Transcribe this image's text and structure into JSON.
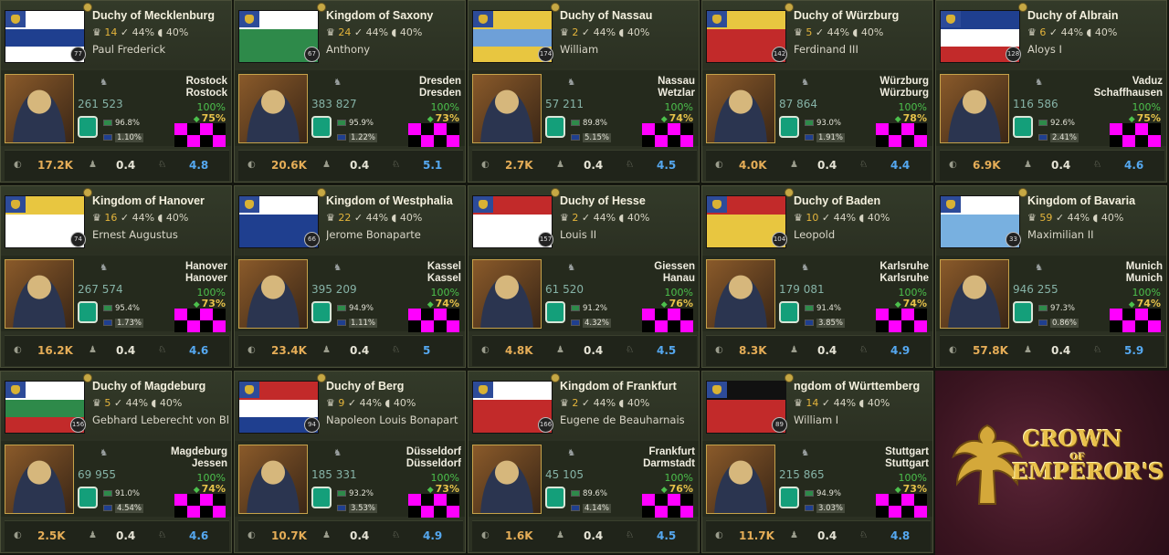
{
  "cards": [
    {
      "name": "Duchy of Mecklenburg",
      "rank": "14",
      "pct_a": "44%",
      "pct_b": "40%",
      "ruler": "Paul Frederick",
      "badge": "77",
      "capital_a": "Rostock",
      "capital_b": "Rostock",
      "pop": "261 523",
      "cult_a": "96.8%",
      "cult_b": "1.10%",
      "happy": "100%",
      "loyalty": "75%",
      "money": "17.2K",
      "mid": "0.4",
      "right": "4.8",
      "flag": [
        "#ffffff",
        "#1f3f8f",
        "#ffffff"
      ]
    },
    {
      "name": "Kingdom of Saxony",
      "rank": "24",
      "pct_a": "44%",
      "pct_b": "40%",
      "ruler": "Anthony",
      "badge": "67",
      "capital_a": "Dresden",
      "capital_b": "Dresden",
      "pop": "383 827",
      "cult_a": "95.9%",
      "cult_b": "1.22%",
      "happy": "100%",
      "loyalty": "73%",
      "money": "20.6K",
      "mid": "0.4",
      "right": "5.1",
      "flag": [
        "#ffffff",
        "#2e8a4a",
        "#2e8a4a"
      ]
    },
    {
      "name": "Duchy of Nassau",
      "rank": "2",
      "pct_a": "44%",
      "pct_b": "40%",
      "ruler": "William",
      "badge": "174",
      "capital_a": "Nassau",
      "capital_b": "Wetzlar",
      "pop": "57 211",
      "cult_a": "89.8%",
      "cult_b": "5.15%",
      "happy": "100%",
      "loyalty": "74%",
      "money": "2.7K",
      "mid": "0.4",
      "right": "4.5",
      "flag": [
        "#e8c640",
        "#6ea0d8",
        "#e8c640"
      ]
    },
    {
      "name": "Duchy of Würzburg",
      "rank": "5",
      "pct_a": "44%",
      "pct_b": "40%",
      "ruler": "Ferdinand III",
      "badge": "142",
      "capital_a": "Würzburg",
      "capital_b": "Würzburg",
      "pop": "87 864",
      "cult_a": "93.0%",
      "cult_b": "1.91%",
      "happy": "100%",
      "loyalty": "78%",
      "money": "4.0K",
      "mid": "0.4",
      "right": "4.4",
      "flag": [
        "#e8c640",
        "#c22a2a",
        "#c22a2a"
      ]
    },
    {
      "name": "Duchy of Albrain",
      "rank": "6",
      "pct_a": "44%",
      "pct_b": "40%",
      "ruler": "Aloys I",
      "badge": "128",
      "capital_a": "Vaduz",
      "capital_b": "Schaffhausen",
      "pop": "116 586",
      "cult_a": "92.6%",
      "cult_b": "2.41%",
      "happy": "100%",
      "loyalty": "75%",
      "money": "6.9K",
      "mid": "0.4",
      "right": "4.6",
      "flag": [
        "#1f3f8f",
        "#ffffff",
        "#c22a2a"
      ]
    },
    {
      "name": "Kingdom of Hanover",
      "rank": "16",
      "pct_a": "44%",
      "pct_b": "40%",
      "ruler": "Ernest Augustus",
      "badge": "74",
      "capital_a": "Hanover",
      "capital_b": "Hanover",
      "pop": "267 574",
      "cult_a": "95.4%",
      "cult_b": "1.73%",
      "happy": "100%",
      "loyalty": "73%",
      "money": "16.2K",
      "mid": "0.4",
      "right": "4.6",
      "flag": [
        "#e8c640",
        "#ffffff",
        "#ffffff"
      ]
    },
    {
      "name": "Kingdom of Westphalia",
      "rank": "22",
      "pct_a": "44%",
      "pct_b": "40%",
      "ruler": "Jerome Bonaparte",
      "badge": "66",
      "capital_a": "Kassel",
      "capital_b": "Kassel",
      "pop": "395 209",
      "cult_a": "94.9%",
      "cult_b": "1.11%",
      "happy": "100%",
      "loyalty": "74%",
      "money": "23.4K",
      "mid": "0.4",
      "right": "5",
      "flag": [
        "#ffffff",
        "#1f3f8f",
        "#1f3f8f"
      ]
    },
    {
      "name": "Duchy of Hesse",
      "rank": "2",
      "pct_a": "44%",
      "pct_b": "40%",
      "ruler": "Louis II",
      "badge": "157",
      "capital_a": "Giessen",
      "capital_b": "Hanau",
      "pop": "61 520",
      "cult_a": "91.2%",
      "cult_b": "4.32%",
      "happy": "100%",
      "loyalty": "76%",
      "money": "4.8K",
      "mid": "0.4",
      "right": "4.5",
      "flag": [
        "#c22a2a",
        "#ffffff",
        "#ffffff"
      ]
    },
    {
      "name": "Duchy of Baden",
      "rank": "10",
      "pct_a": "44%",
      "pct_b": "40%",
      "ruler": "Leopold",
      "badge": "104",
      "capital_a": "Karlsruhe",
      "capital_b": "Karlsruhe",
      "pop": "179 081",
      "cult_a": "91.4%",
      "cult_b": "3.85%",
      "happy": "100%",
      "loyalty": "74%",
      "money": "8.3K",
      "mid": "0.4",
      "right": "4.9",
      "flag": [
        "#c22a2a",
        "#e8c640",
        "#e8c640"
      ]
    },
    {
      "name": "Kingdom of Bavaria",
      "rank": "59",
      "pct_a": "44%",
      "pct_b": "40%",
      "ruler": "Maximilian II",
      "badge": "33",
      "capital_a": "Munich",
      "capital_b": "Munich",
      "pop": "946 255",
      "cult_a": "97.3%",
      "cult_b": "0.86%",
      "happy": "100%",
      "loyalty": "74%",
      "money": "57.8K",
      "mid": "0.4",
      "right": "5.9",
      "flag": [
        "#ffffff",
        "#78b0e0",
        "#78b0e0"
      ]
    },
    {
      "name": "Duchy of Magdeburg",
      "rank": "5",
      "pct_a": "44%",
      "pct_b": "40%",
      "ruler": "Gebhard Leberecht von Bl",
      "badge": "156",
      "capital_a": "Magdeburg",
      "capital_b": "Jessen",
      "pop": "69 955",
      "cult_a": "91.0%",
      "cult_b": "4.54%",
      "happy": "100%",
      "loyalty": "74%",
      "money": "2.5K",
      "mid": "0.4",
      "right": "4.6",
      "flag": [
        "#ffffff",
        "#2e8a4a",
        "#c22a2a"
      ]
    },
    {
      "name": "Duchy of Berg",
      "rank": "9",
      "pct_a": "44%",
      "pct_b": "40%",
      "ruler": "Napoleon Louis Bonapart",
      "badge": "94",
      "capital_a": "Düsseldorf",
      "capital_b": "Düsseldorf",
      "pop": "185 331",
      "cult_a": "93.2%",
      "cult_b": "3.53%",
      "happy": "100%",
      "loyalty": "73%",
      "money": "10.7K",
      "mid": "0.4",
      "right": "4.9",
      "flag": [
        "#c22a2a",
        "#ffffff",
        "#1f3f8f"
      ]
    },
    {
      "name": "Kingdom of Frankfurt",
      "rank": "2",
      "pct_a": "44%",
      "pct_b": "40%",
      "ruler": "Eugene de Beauharnais",
      "badge": "166",
      "capital_a": "Frankfurt",
      "capital_b": "Darmstadt",
      "pop": "45 105",
      "cult_a": "89.6%",
      "cult_b": "4.14%",
      "happy": "100%",
      "loyalty": "76%",
      "money": "1.6K",
      "mid": "0.4",
      "right": "4.5",
      "flag": [
        "#ffffff",
        "#c22a2a",
        "#c22a2a"
      ]
    },
    {
      "name": "ngdom of Württemberg",
      "rank": "14",
      "pct_a": "44%",
      "pct_b": "40%",
      "ruler": "William I",
      "badge": "89",
      "capital_a": "Stuttgart",
      "capital_b": "Stuttgart",
      "pop": "215 865",
      "cult_a": "94.9%",
      "cult_b": "3.03%",
      "happy": "100%",
      "loyalty": "73%",
      "money": "11.7K",
      "mid": "0.4",
      "right": "4.8",
      "flag": [
        "#111111",
        "#c22a2a",
        "#c22a2a"
      ]
    }
  ],
  "promo": {
    "line1": "CROWN",
    "line2": "OF",
    "line3": "EMPEROR'S"
  },
  "icons": {
    "rank": "crown-rank-icon",
    "pct_a": "quill-icon",
    "pct_b": "shield-icon",
    "pop": "population-icon",
    "money": "money-bag-icon",
    "mid": "soldier-icon",
    "right": "horse-icon"
  },
  "colors": {
    "checker": "#ff00ff",
    "teal": "#149f7a",
    "money": "#e5ad57",
    "right": "#55a8f0",
    "loyal": "#e6c24a"
  }
}
